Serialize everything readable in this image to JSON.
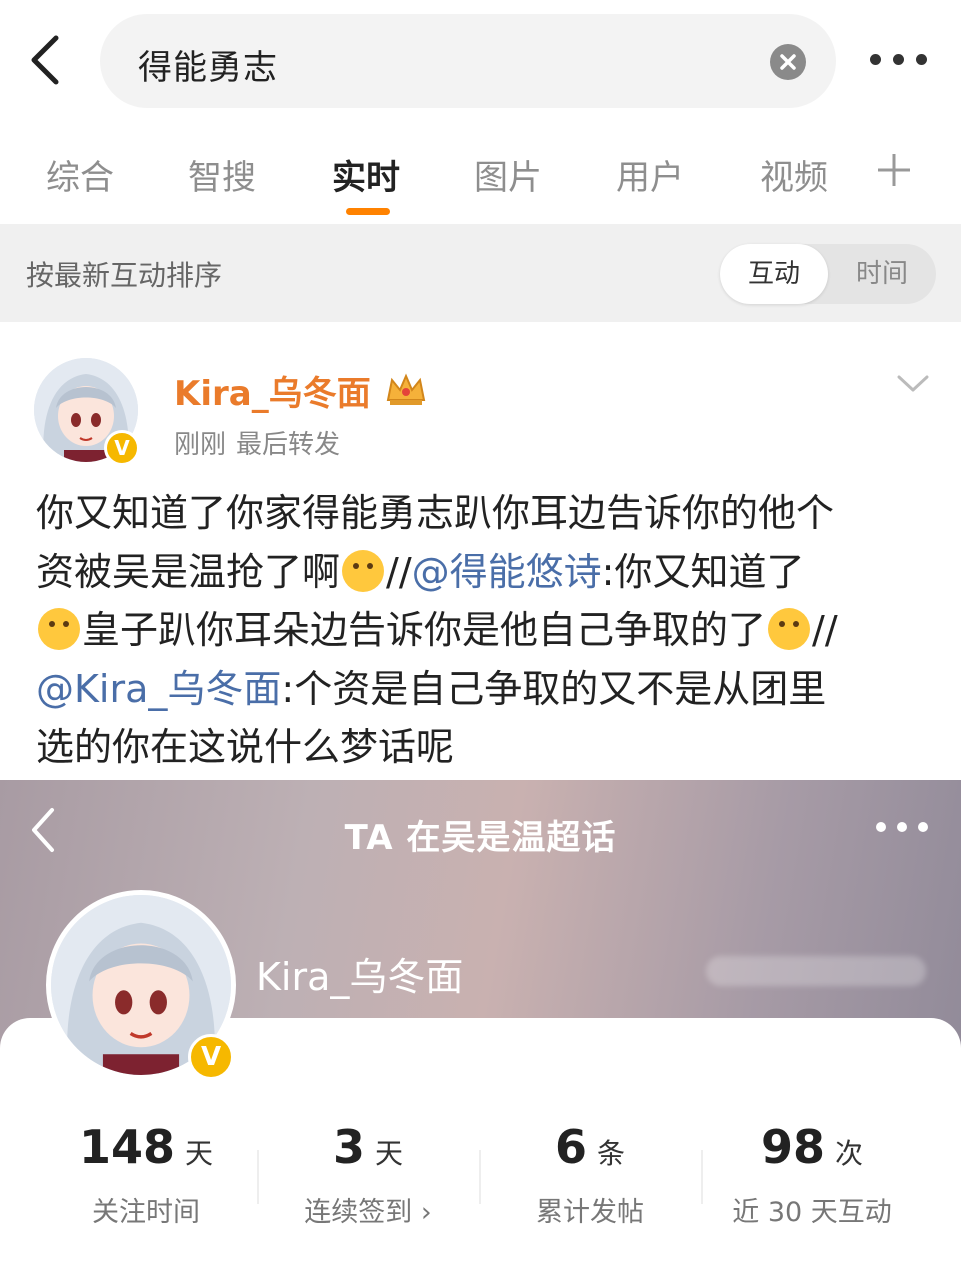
{
  "search": {
    "query": "得能勇志"
  },
  "tabs": [
    {
      "label": "综合",
      "active": false
    },
    {
      "label": "智搜",
      "active": false
    },
    {
      "label": "实时",
      "active": true
    },
    {
      "label": "图片",
      "active": false
    },
    {
      "label": "用户",
      "active": false
    },
    {
      "label": "视频",
      "active": false
    }
  ],
  "colors": {
    "accent": "#ff8200",
    "username": "#ea7b2b",
    "mention": "#4a6ea8",
    "verified": "#f6b800"
  },
  "sort": {
    "label": "按最新互动排序",
    "options": [
      "互动",
      "时间"
    ],
    "selected": "互动"
  },
  "post": {
    "username": "Kira_乌冬面",
    "time": "刚刚",
    "action": "最后转发",
    "body": {
      "line1": "你又知道了你家得能勇志趴你耳边告诉你的他个",
      "line2a": "资被吴是温抢了啊",
      "sep1": "//",
      "mention1": "@得能悠诗",
      "line2b": ":你又知道了",
      "line3": "皇子趴你耳朵边告诉你是他自己争取的了",
      "sep2": "//",
      "mention2": "@Kira_乌冬面",
      "line4": ":个资是自己争取的又不是从团里",
      "line5": "选的你在这说什么梦话呢"
    }
  },
  "card": {
    "title": "TA 在吴是温超话",
    "username": "Kira_乌冬面",
    "stats": [
      {
        "value": "148",
        "unit": "天",
        "label": "关注时间"
      },
      {
        "value": "3",
        "unit": "天",
        "label": "连续签到 ›"
      },
      {
        "value": "6",
        "unit": "条",
        "label": "累计发帖"
      },
      {
        "value": "98",
        "unit": "次",
        "label": "近 30 天互动"
      }
    ]
  }
}
